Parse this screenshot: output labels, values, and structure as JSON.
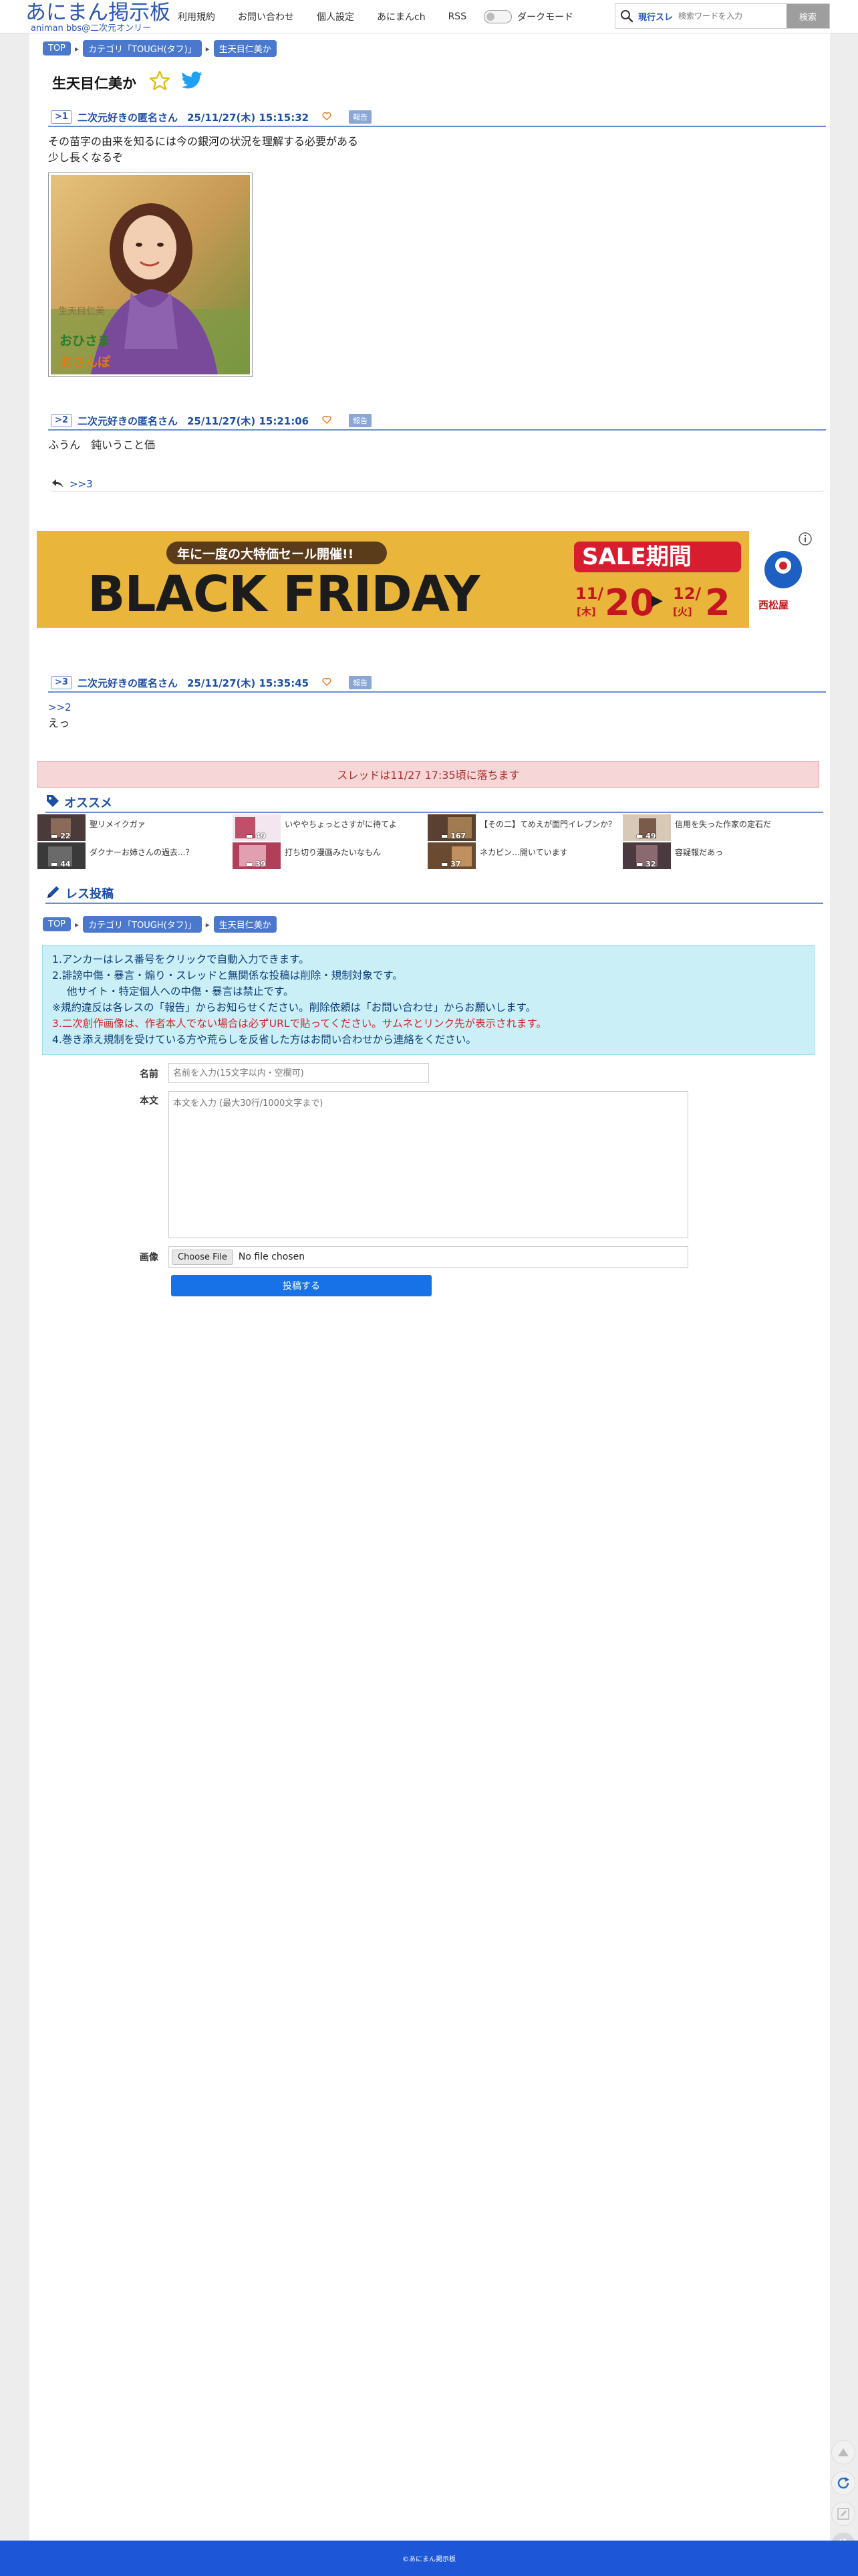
{
  "header": {
    "logo_title": "あにまん掲示板",
    "logo_sub": "animan bbs@二次元オンリー",
    "nav": [
      "利用規約",
      "お問い合わせ",
      "個人設定",
      "あにまんch",
      "RSS"
    ],
    "dark_mode_label": "ダークモード",
    "search_mode": "現行スレ",
    "search_placeholder": "検索ワードを入力",
    "search_button": "検索"
  },
  "breadcrumb": [
    "TOP",
    "カテゴリ「TOUGH(タフ)」",
    "生天目仁美か"
  ],
  "thread": {
    "title": "生天目仁美か"
  },
  "posts": [
    {
      "num": "1",
      "name": "二次元好きの匿名さん",
      "date": "25/11/27(木) 15:15:32",
      "report": "報告",
      "lines": [
        "その苗字の由来を知るには今の銀河の状況を理解する必要がある",
        "少し長くなるぞ"
      ],
      "image_caption": [
        "生天目仁美",
        "おひさま",
        "おさんぽ"
      ]
    },
    {
      "num": "2",
      "name": "二次元好きの匿名さん",
      "date": "25/11/27(木) 15:21:06",
      "report": "報告",
      "lines": [
        "ふうん　鈍いうこと価"
      ],
      "reply_link": ">>3"
    },
    {
      "num": "3",
      "name": "二次元好きの匿名さん",
      "date": "25/11/27(木) 15:35:45",
      "report": "報告",
      "anchor": ">>2",
      "lines": [
        "えっ"
      ]
    }
  ],
  "banner": {
    "tagline": "年に一度の大特価セール開催!!",
    "headline": "BLACK FRIDAY",
    "sale_label": "SALE期間",
    "start_month": "11/",
    "start_day": "20",
    "start_weekday": "[木]",
    "end_month": "12/",
    "end_day": "2",
    "end_weekday": "[火]",
    "brand": "西松屋"
  },
  "expire_notice": "スレッドは11/27 17:35頃に落ちます",
  "recommend": {
    "title": "オススメ",
    "items": [
      {
        "title": "聖リメイクガァ",
        "count": "22"
      },
      {
        "title": "いややちょっとさすがに待てよ",
        "count": "49"
      },
      {
        "title": "【その二】てめえが面門イレブンか？",
        "count": "167"
      },
      {
        "title": "信用を失った作家の定石だ",
        "count": "49"
      },
      {
        "title": "ダクナーお姉さんの過去...？",
        "count": "44"
      },
      {
        "title": "打ち切り漫画みたいなもん",
        "count": "39"
      },
      {
        "title": "ネカピン…開いています",
        "count": "37"
      },
      {
        "title": "容疑報だあっ",
        "count": "32"
      }
    ]
  },
  "reply_form": {
    "title": "レス投稿",
    "rules": [
      "1.アンカーはレス番号をクリックで自動入力できます。",
      "2.誹謗中傷・暴言・煽り・スレッドと無関係な投稿は削除・規制対象です。",
      "他サイト・特定個人への中傷・暴言は禁止です。",
      "※規約違反は各レスの「報告」からお知らせください。削除依頼は「お問い合わせ」からお願いします。",
      "3.二次創作画像は、作者本人でない場合は必ずURLで貼ってください。サムネとリンク先が表示されます。",
      "4.巻き添え規制を受けている方や荒らしを反省した方はお問い合わせから連絡をください。"
    ],
    "name_label": "名前",
    "name_placeholder": "名前を入力(15文字以内・空欄可)",
    "body_label": "本文",
    "body_placeholder": "本文を入力 (最大30行/1000文字まで)",
    "image_label": "画像",
    "file_button": "Choose File",
    "file_status": "No file chosen",
    "submit": "投稿する"
  },
  "footer": {
    "copyright": "©あにまん掲示板"
  },
  "colors": {
    "accent": "#1c4ea6",
    "footer": "#1d56d6",
    "banner": "#eab53b"
  },
  "icons": [
    "search-icon",
    "star-icon",
    "twitter-icon",
    "heart-icon",
    "reply-icon",
    "tag-icon",
    "pencil-icon",
    "arrow-up-icon",
    "refresh-icon",
    "edit-icon",
    "gear-icon"
  ]
}
